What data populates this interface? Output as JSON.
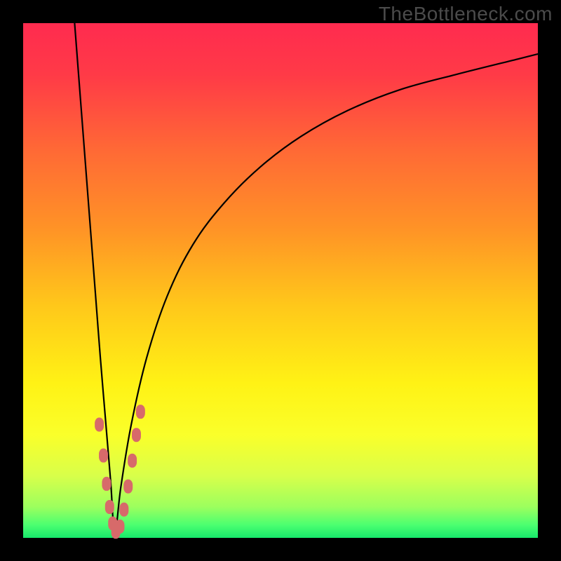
{
  "watermark": "TheBottleneck.com",
  "chart_data": {
    "type": "line",
    "title": "",
    "xlabel": "",
    "ylabel": "",
    "xlim": [
      0,
      100
    ],
    "ylim": [
      0,
      100
    ],
    "gradient_stops": [
      {
        "offset": 0,
        "color": "#ff2b4f"
      },
      {
        "offset": 0.1,
        "color": "#ff3a47"
      },
      {
        "offset": 0.25,
        "color": "#ff6a35"
      },
      {
        "offset": 0.4,
        "color": "#ff9326"
      },
      {
        "offset": 0.55,
        "color": "#ffc81a"
      },
      {
        "offset": 0.7,
        "color": "#fff215"
      },
      {
        "offset": 0.8,
        "color": "#faff2a"
      },
      {
        "offset": 0.88,
        "color": "#d8ff4a"
      },
      {
        "offset": 0.94,
        "color": "#9cff5e"
      },
      {
        "offset": 0.975,
        "color": "#4bff70"
      },
      {
        "offset": 1.0,
        "color": "#17e86b"
      }
    ],
    "series": [
      {
        "name": "left-branch",
        "x": [
          10.0,
          11.0,
          12.0,
          13.0,
          14.0,
          15.0,
          16.0,
          17.0,
          17.8
        ],
        "y": [
          100.0,
          87.0,
          74.0,
          61.0,
          48.0,
          35.0,
          23.0,
          11.0,
          1.0
        ]
      },
      {
        "name": "right-branch",
        "x": [
          17.8,
          19.0,
          21.0,
          24.0,
          28.0,
          33.0,
          39.0,
          46.0,
          54.0,
          63.0,
          73.0,
          84.0,
          96.0,
          100.0
        ],
        "y": [
          1.0,
          10.0,
          22.0,
          35.0,
          47.0,
          57.0,
          65.0,
          72.0,
          78.0,
          83.0,
          87.0,
          90.0,
          93.0,
          94.0
        ]
      }
    ],
    "markers": {
      "name": "highlight-dots",
      "color": "#d76a6a",
      "points": [
        {
          "x": 14.8,
          "y": 22.0
        },
        {
          "x": 15.6,
          "y": 16.0
        },
        {
          "x": 16.2,
          "y": 10.5
        },
        {
          "x": 16.8,
          "y": 6.0
        },
        {
          "x": 17.4,
          "y": 2.8
        },
        {
          "x": 18.0,
          "y": 1.2
        },
        {
          "x": 18.8,
          "y": 2.2
        },
        {
          "x": 19.6,
          "y": 5.5
        },
        {
          "x": 20.4,
          "y": 10.0
        },
        {
          "x": 21.2,
          "y": 15.0
        },
        {
          "x": 22.0,
          "y": 20.0
        },
        {
          "x": 22.8,
          "y": 24.5
        }
      ]
    }
  }
}
